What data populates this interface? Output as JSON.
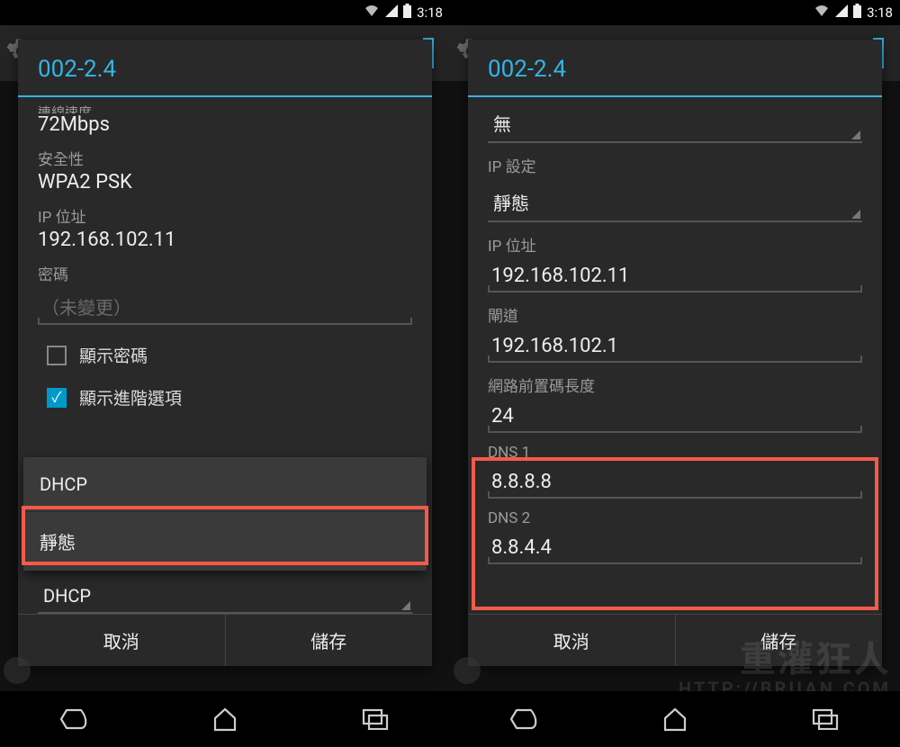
{
  "statusbar": {
    "time": "3:18"
  },
  "left": {
    "dialog_title": "002-2.4",
    "link_speed_label_cut": "連線速度",
    "link_speed_value": "72Mbps",
    "security_label": "安全性",
    "security_value": "WPA2 PSK",
    "ip_label": "IP 位址",
    "ip_value": "192.168.102.11",
    "password_label": "密碼",
    "password_placeholder": "（未變更）",
    "show_password_label": "顯示密碼",
    "show_advanced_label": "顯示進階選項",
    "dropdown_items": [
      "DHCP",
      "靜態"
    ],
    "ip_settings_selected": "DHCP",
    "cancel_label": "取消",
    "save_label": "儲存"
  },
  "right": {
    "dialog_title": "002-2.4",
    "proxy_value": "無",
    "ip_settings_label": "IP 設定",
    "ip_settings_value": "靜態",
    "ip_addr_label": "IP 位址",
    "ip_addr_value": "192.168.102.11",
    "gateway_label": "閘道",
    "gateway_value": "192.168.102.1",
    "prefix_label": "網路前置碼長度",
    "prefix_value": "24",
    "dns1_label": "DNS 1",
    "dns1_value": "8.8.8.8",
    "dns2_label": "DNS 2",
    "dns2_value": "8.8.4.4",
    "cancel_label": "取消",
    "save_label": "儲存"
  },
  "watermark": {
    "line1": "重灌狂人",
    "line2": "HTTP://BRIIAN.COM"
  }
}
